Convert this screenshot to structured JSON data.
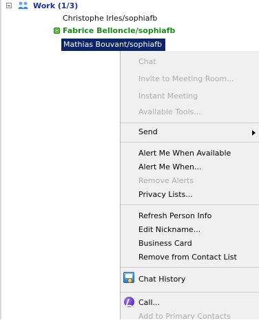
{
  "tree": {
    "group_label": "Work (1/3)",
    "contacts": [
      "Christophe Irles/sophiafb",
      "Fabrice Belloncle/sophiafb",
      "Mathias Bouvant/sophiafb"
    ]
  },
  "context_menu": {
    "items": [
      {
        "label": "Chat",
        "enabled": false
      },
      {
        "label": "Invite to Meeting Room...",
        "enabled": false
      },
      {
        "label": "Instant Meeting",
        "enabled": false
      },
      {
        "label": "Available Tools...",
        "enabled": false
      },
      {
        "label": "Send",
        "enabled": true
      },
      {
        "label": "Alert Me When Available",
        "enabled": true
      },
      {
        "label": "Alert Me When...",
        "enabled": true
      },
      {
        "label": "Remove Alerts",
        "enabled": false
      },
      {
        "label": "Privacy Lists...",
        "enabled": true
      },
      {
        "label": "Refresh Person Info",
        "enabled": true
      },
      {
        "label": "Edit Nickname...",
        "enabled": true
      },
      {
        "label": "Business Card",
        "enabled": true
      },
      {
        "label": "Remove from Contact List",
        "enabled": true
      },
      {
        "label": "Chat History",
        "enabled": true
      },
      {
        "label": "Call...",
        "enabled": true
      },
      {
        "label": "Add to Primary Contacts",
        "enabled": false
      }
    ]
  },
  "icons": {
    "group": "group-icon",
    "status": "available-status-icon",
    "history": "chat-history-icon",
    "call": "call-icon",
    "submenu": "submenu-arrow-icon"
  },
  "colors": {
    "selected_row": "#0a2468",
    "group_text": "#17309e",
    "online_contact": "#1b8a18",
    "menu_background": "#f0f0f0",
    "disabled_text": "#adadad"
  }
}
